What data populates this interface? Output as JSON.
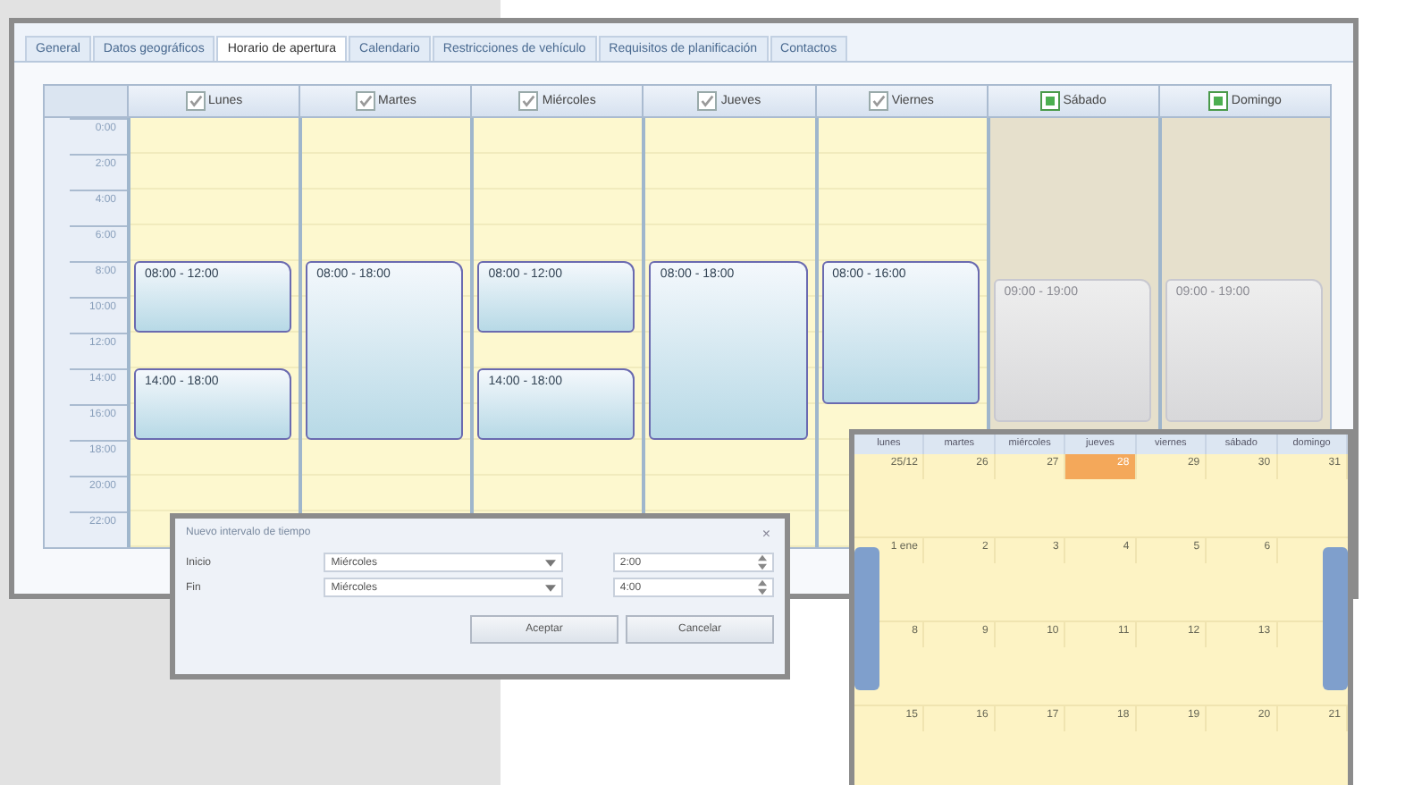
{
  "tabs": [
    {
      "label": "General",
      "selected": false
    },
    {
      "label": "Datos geográficos",
      "selected": false
    },
    {
      "label": "Horario de apertura",
      "selected": true
    },
    {
      "label": "Calendario",
      "selected": false
    },
    {
      "label": "Restricciones de vehículo",
      "selected": false
    },
    {
      "label": "Requisitos de planificación",
      "selected": false
    },
    {
      "label": "Contactos",
      "selected": false
    }
  ],
  "times": [
    "0:00",
    "2:00",
    "4:00",
    "6:00",
    "8:00",
    "10:00",
    "12:00",
    "14:00",
    "16:00",
    "18:00",
    "20:00",
    "22:00"
  ],
  "days": [
    {
      "name": "Lunes",
      "checked": true,
      "enabled": true,
      "blocks": [
        "08:00 - 12:00",
        "14:00 - 18:00"
      ]
    },
    {
      "name": "Martes",
      "checked": true,
      "enabled": true,
      "blocks": [
        "08:00 - 18:00"
      ]
    },
    {
      "name": "Miércoles",
      "checked": true,
      "enabled": true,
      "blocks": [
        "08:00 - 12:00",
        "14:00 - 18:00"
      ]
    },
    {
      "name": "Jueves",
      "checked": true,
      "enabled": true,
      "blocks": [
        "08:00 - 18:00"
      ]
    },
    {
      "name": "Viernes",
      "checked": true,
      "enabled": true,
      "blocks": [
        "08:00 - 16:00"
      ]
    },
    {
      "name": "Sábado",
      "checked": true,
      "enabled": false,
      "blocks": [
        "09:00 - 19:00"
      ]
    },
    {
      "name": "Domingo",
      "checked": true,
      "enabled": false,
      "blocks": [
        "09:00 - 19:00"
      ]
    }
  ],
  "dialog": {
    "title": "Nuevo intervalo de tiempo",
    "close": "×",
    "rows": [
      {
        "label": "Inicio",
        "day": "Miércoles",
        "time": "2:00"
      },
      {
        "label": "Fin",
        "day": "Miércoles",
        "time": "4:00"
      }
    ],
    "buttons": [
      "Aceptar",
      "Cancelar"
    ]
  },
  "calendar": {
    "weekdays": [
      "lunes",
      "martes",
      "miércoles",
      "jueves",
      "viernes",
      "sábado",
      "domingo"
    ],
    "weeks": [
      [
        {
          "day": "25/12",
          "selected": false
        },
        {
          "day": "26",
          "selected": false
        },
        {
          "day": "27",
          "selected": false
        },
        {
          "day": "28",
          "selected": true
        },
        {
          "day": "29",
          "selected": false
        },
        {
          "day": "30",
          "selected": false
        },
        {
          "day": "31",
          "selected": false
        }
      ],
      [
        {
          "day": "1 ene",
          "selected": false
        },
        {
          "day": "2",
          "selected": false
        },
        {
          "day": "3",
          "selected": false
        },
        {
          "day": "4",
          "selected": false
        },
        {
          "day": "5",
          "selected": false
        },
        {
          "day": "6",
          "selected": false
        }
      ],
      [
        {
          "day": "8",
          "selected": false
        },
        {
          "day": "9",
          "selected": false
        },
        {
          "day": "10",
          "selected": false
        },
        {
          "day": "11",
          "selected": false
        },
        {
          "day": "12",
          "selected": false
        },
        {
          "day": "13",
          "selected": false
        }
      ],
      [
        {
          "day": "15",
          "selected": false
        },
        {
          "day": "16",
          "selected": false
        },
        {
          "day": "17",
          "selected": false
        },
        {
          "day": "18",
          "selected": false
        },
        {
          "day": "19",
          "selected": false
        },
        {
          "day": "20",
          "selected": false
        },
        {
          "day": "21",
          "selected": false
        }
      ]
    ]
  }
}
